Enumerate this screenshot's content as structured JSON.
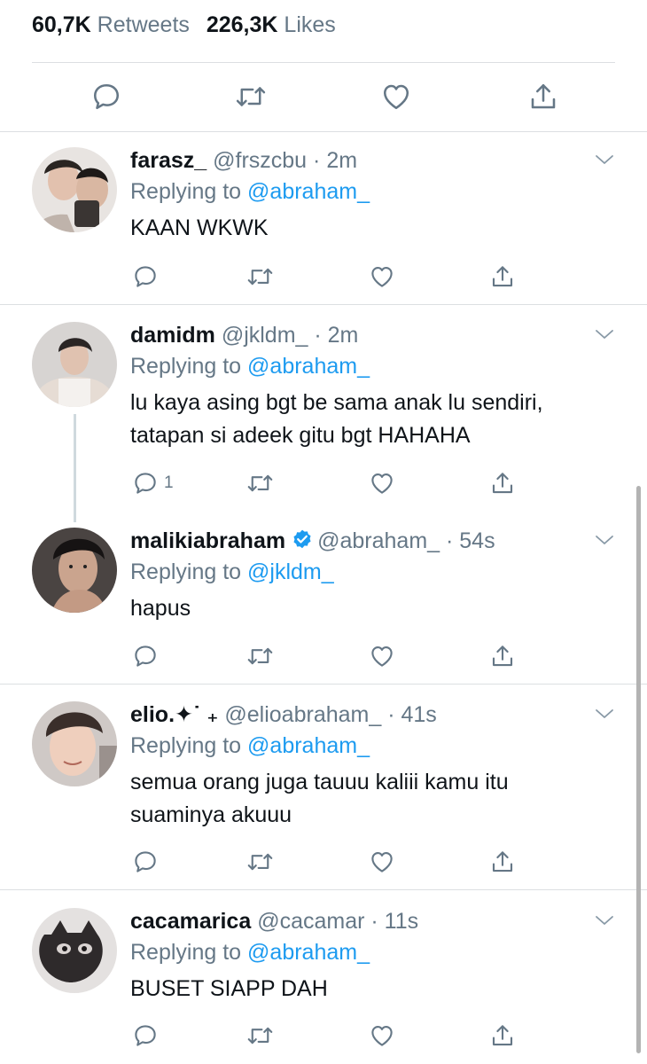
{
  "stats": {
    "retweets_count": "60,7K",
    "retweets_label": "Retweets",
    "likes_count": "226,3K",
    "likes_label": "Likes"
  },
  "icons": {
    "reply": "reply-icon",
    "retweet": "retweet-icon",
    "like": "heart-icon",
    "share": "share-icon",
    "more": "chevron-down-icon",
    "verified": "verified-badge-icon"
  },
  "colors": {
    "mention": "#1d9bf0",
    "secondary_text": "#657786",
    "icon": "#657786",
    "verified": "#1d9bf0",
    "divider": "#dcdfe2"
  },
  "replies": [
    {
      "name": "farasz_",
      "handle": "@frszcbu",
      "time": "2m",
      "replying_label": "Replying to",
      "replying_to": "@abraham_",
      "lines": [
        "KAAN WKWK"
      ],
      "reply_count": ""
    },
    {
      "name": "damidm",
      "handle": "@jkldm_",
      "time": "2m",
      "replying_label": "Replying to",
      "replying_to": "@abraham_",
      "lines": [
        "lu kaya asing bgt be sama anak lu sendiri,",
        "tatapan si adeek gitu bgt HAHAHA"
      ],
      "reply_count": "1"
    },
    {
      "name": "malikiabraham",
      "verified": true,
      "handle": "@abraham_",
      "time": "54s",
      "replying_label": "Replying to",
      "replying_to": "@jkldm_",
      "lines": [
        "hapus"
      ],
      "reply_count": ""
    },
    {
      "name": "elio.✦˙ ₊",
      "handle": "@elioabraham_",
      "time": "41s",
      "replying_label": "Replying to",
      "replying_to": "@abraham_",
      "lines": [
        "semua orang juga tauuu kaliii kamu itu",
        "suaminya akuuu"
      ],
      "reply_count": ""
    },
    {
      "name": "cacamarica",
      "handle": "@cacamar",
      "time": "11s",
      "replying_label": "Replying to",
      "replying_to": "@abraham_",
      "lines": [
        "BUSET SIAPP DAH"
      ],
      "reply_count": ""
    }
  ]
}
